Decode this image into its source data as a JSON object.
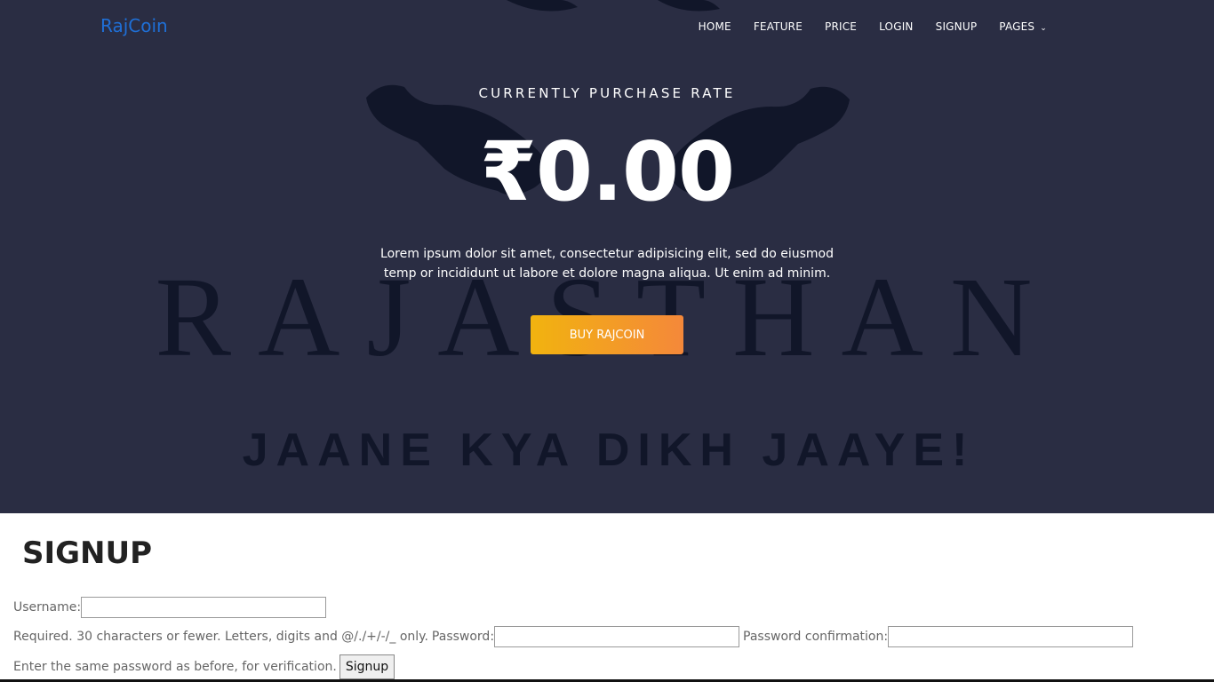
{
  "nav": {
    "brand": "RajCoin",
    "items": [
      "HOME",
      "FEATURE",
      "PRICE",
      "LOGIN",
      "SIGNUP",
      "PAGES"
    ]
  },
  "hero": {
    "rate_label": "CURRENTLY PURCHASE RATE",
    "rate_value": "₹0.00",
    "description": "Lorem ipsum dolor sit amet, consectetur adipisicing elit, sed do eiusmod temp or incididunt ut labore et dolore magna aliqua. Ut enim ad minim.",
    "buy_button": "BUY RAJCOIN",
    "background_word": "RAJASTHAN",
    "background_tagline": "JAANE KYA DIKH JAAYE!"
  },
  "signup": {
    "heading": "SIGNUP",
    "username_label": "Username:",
    "username_help": "Required. 30 characters or fewer. Letters, digits and @/./+/-/_ only.",
    "password_label": "Password:",
    "password_confirm_label": "Password confirmation:",
    "password_help": "Enter the same password as before, for verification.",
    "submit": "Signup"
  },
  "colors": {
    "hero_bg": "#2a2d43",
    "brand": "#1f6fd6",
    "button_start": "#f2b30f",
    "button_end": "#f4883a"
  }
}
